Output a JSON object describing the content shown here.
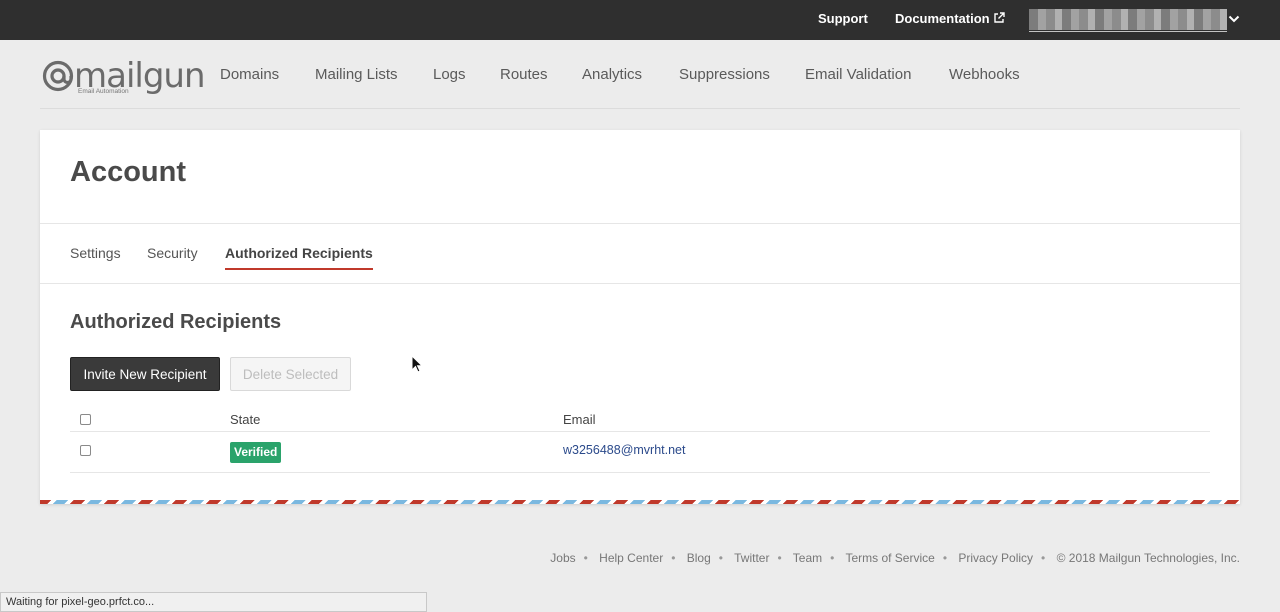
{
  "topbar": {
    "support": "Support",
    "documentation": "Documentation"
  },
  "brand": {
    "name": "mailgun",
    "tagline": "Email Automation"
  },
  "nav": {
    "items": [
      "Domains",
      "Mailing Lists",
      "Logs",
      "Routes",
      "Analytics",
      "Suppressions",
      "Email Validation",
      "Webhooks"
    ]
  },
  "page": {
    "title": "Account",
    "tabs": [
      {
        "label": "Settings"
      },
      {
        "label": "Security"
      },
      {
        "label": "Authorized Recipients"
      }
    ],
    "active_tab": "Authorized Recipients"
  },
  "section": {
    "title": "Authorized Recipients",
    "invite_button": "Invite New Recipient",
    "delete_button": "Delete Selected"
  },
  "table": {
    "headers": {
      "state": "State",
      "email": "Email"
    },
    "rows": [
      {
        "state": "Verified",
        "email": "w3256488@mvrht.net"
      }
    ]
  },
  "footer": {
    "links": [
      "Jobs",
      "Help Center",
      "Blog",
      "Twitter",
      "Team",
      "Terms of Service",
      "Privacy Policy"
    ],
    "copyright": "© 2018 Mailgun Technologies, Inc."
  },
  "status_bar": "Waiting for pixel-geo.prfct.co...",
  "colors": {
    "topbar": "#2f2f2f",
    "accent": "#c0392b",
    "verified": "#2aa36b",
    "link": "#2b4a8b"
  }
}
